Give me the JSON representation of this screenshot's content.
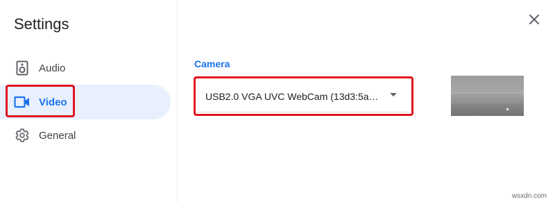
{
  "dialog": {
    "title": "Settings",
    "close_icon": "close-icon"
  },
  "sidebar": {
    "items": [
      {
        "label": "Audio",
        "icon": "speaker-icon",
        "active": false
      },
      {
        "label": "Video",
        "icon": "videocam-icon",
        "active": true
      },
      {
        "label": "General",
        "icon": "gear-icon",
        "active": false
      }
    ]
  },
  "main": {
    "section_label": "Camera",
    "camera_select": {
      "value": "USB2.0 VGA UVC WebCam (13d3:5a…",
      "icon": "dropdown-arrow-icon"
    }
  },
  "colors": {
    "accent": "#1a73e8",
    "active_bg": "#e8f0fe",
    "highlight": "#e0141e"
  },
  "watermark": "wsxdn.com"
}
